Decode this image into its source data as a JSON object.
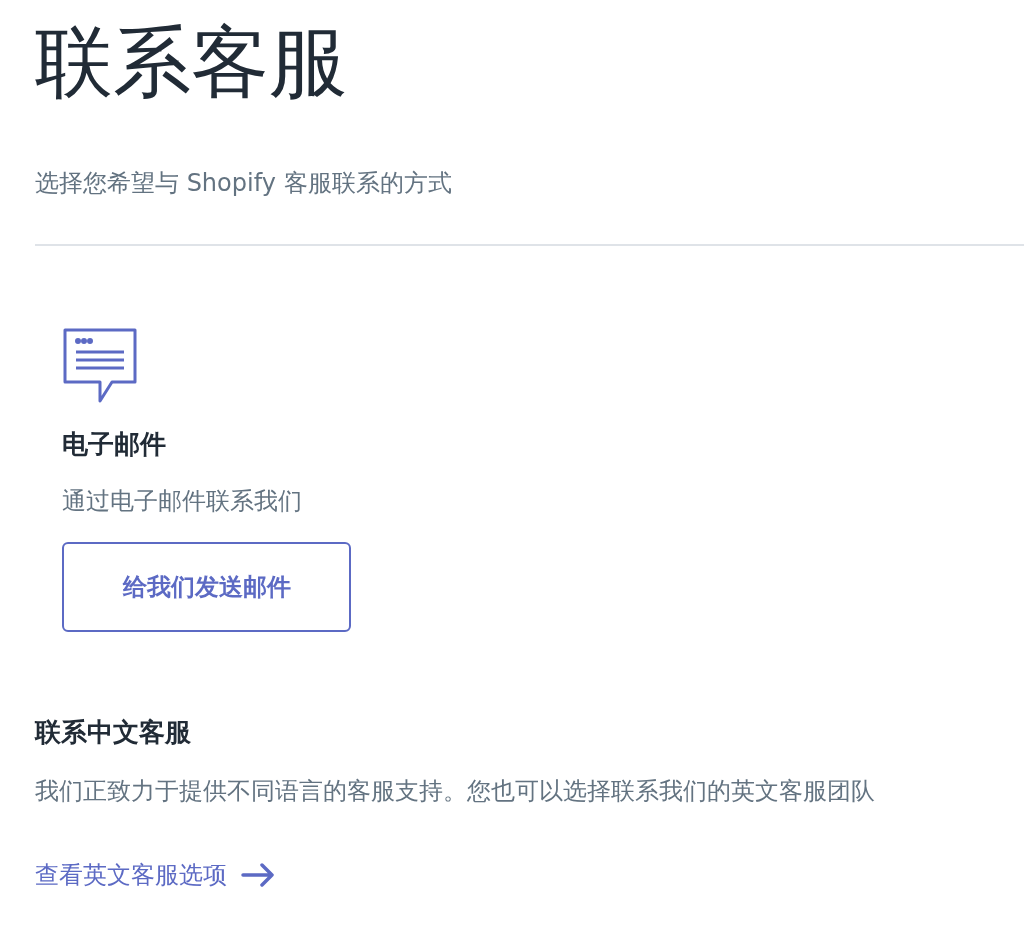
{
  "page": {
    "title": "联系客服",
    "subtitle": "选择您希望与 Shopify 客服联系的方式"
  },
  "contact_option": {
    "title": "电子邮件",
    "description": "通过电子邮件联系我们",
    "button": "给我们发送邮件"
  },
  "chinese_support": {
    "title": "联系中文客服",
    "description": "我们正致力于提供不同语言的客服支持。您也可以选择联系我们的英文客服团队",
    "link": "查看英文客服选项"
  }
}
